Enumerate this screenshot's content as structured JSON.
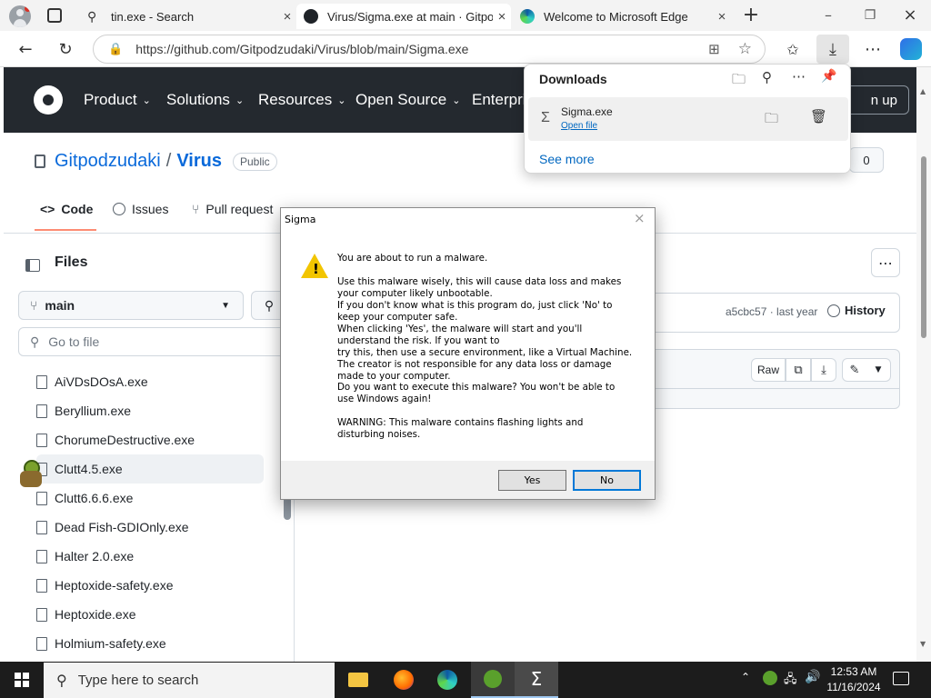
{
  "browser": {
    "tabs": [
      {
        "label": "tin.exe - Search",
        "icon": "search-icon"
      },
      {
        "label": "Virus/Sigma.exe at main · Gitpod",
        "icon": "github-icon"
      },
      {
        "label": "Welcome to Microsoft Edge",
        "icon": "edge-icon"
      }
    ],
    "url": "https://github.com/Gitpodzudaki/Virus/blob/main/Sigma.exe"
  },
  "github": {
    "nav": [
      "Product",
      "Solutions",
      "Resources",
      "Open Source",
      "Enterpri"
    ],
    "signup": "n up",
    "owner": "Gitpodzudaki",
    "separator": "/",
    "repo": "Virus",
    "visibility": "Public",
    "star_count": "0",
    "tabs": [
      "Code",
      "Issues",
      "Pull request"
    ],
    "files_title": "Files",
    "branch": "main",
    "goto_placeholder": "Go to file",
    "files": [
      "AiVDsDOsA.exe",
      "Beryllium.exe",
      "ChorumeDestructive.exe",
      "Clutt4.5.exe",
      "Clutt6.6.6.exe",
      "Dead Fish-GDIOnly.exe",
      "Halter 2.0.exe",
      "Heptoxide-safety.exe",
      "Heptoxide.exe",
      "Holmium-safety.exe"
    ],
    "commit": "a5cbc57 · last year",
    "history": "History",
    "raw": "Raw"
  },
  "downloads": {
    "title": "Downloads",
    "file_name": "Sigma.exe",
    "open_file": "Open file",
    "see_more": "See more"
  },
  "dialog": {
    "title": "Sigma",
    "close": "×",
    "lines": [
      "You are about to run a malware.",
      "",
      "Use this malware wisely, this will cause data loss and makes",
      "your computer likely unbootable.",
      "If you don't know what is this program do, just click 'No' to",
      "keep your computer safe.",
      "When clicking 'Yes', the malware will start and you'll",
      "understand the risk. If you want to",
      "try this, then use a secure environment, like a Virtual Machine.",
      "The creator is not responsible for any data loss or damage",
      "made to your computer.",
      "Do you want to execute this malware? You won't be able to",
      "use Windows again!",
      "",
      "WARNING: This malware contains flashing lights and",
      "disturbing noises."
    ],
    "yes": "Yes",
    "no": "No"
  },
  "taskbar": {
    "search_placeholder": "Type here to search",
    "time": "12:53 AM",
    "date": "11/16/2024"
  },
  "colors": {
    "github_header": "#24292f",
    "link": "#0969da",
    "taskbar": "#1c1c1c",
    "edge_blue": "#0067c0"
  }
}
